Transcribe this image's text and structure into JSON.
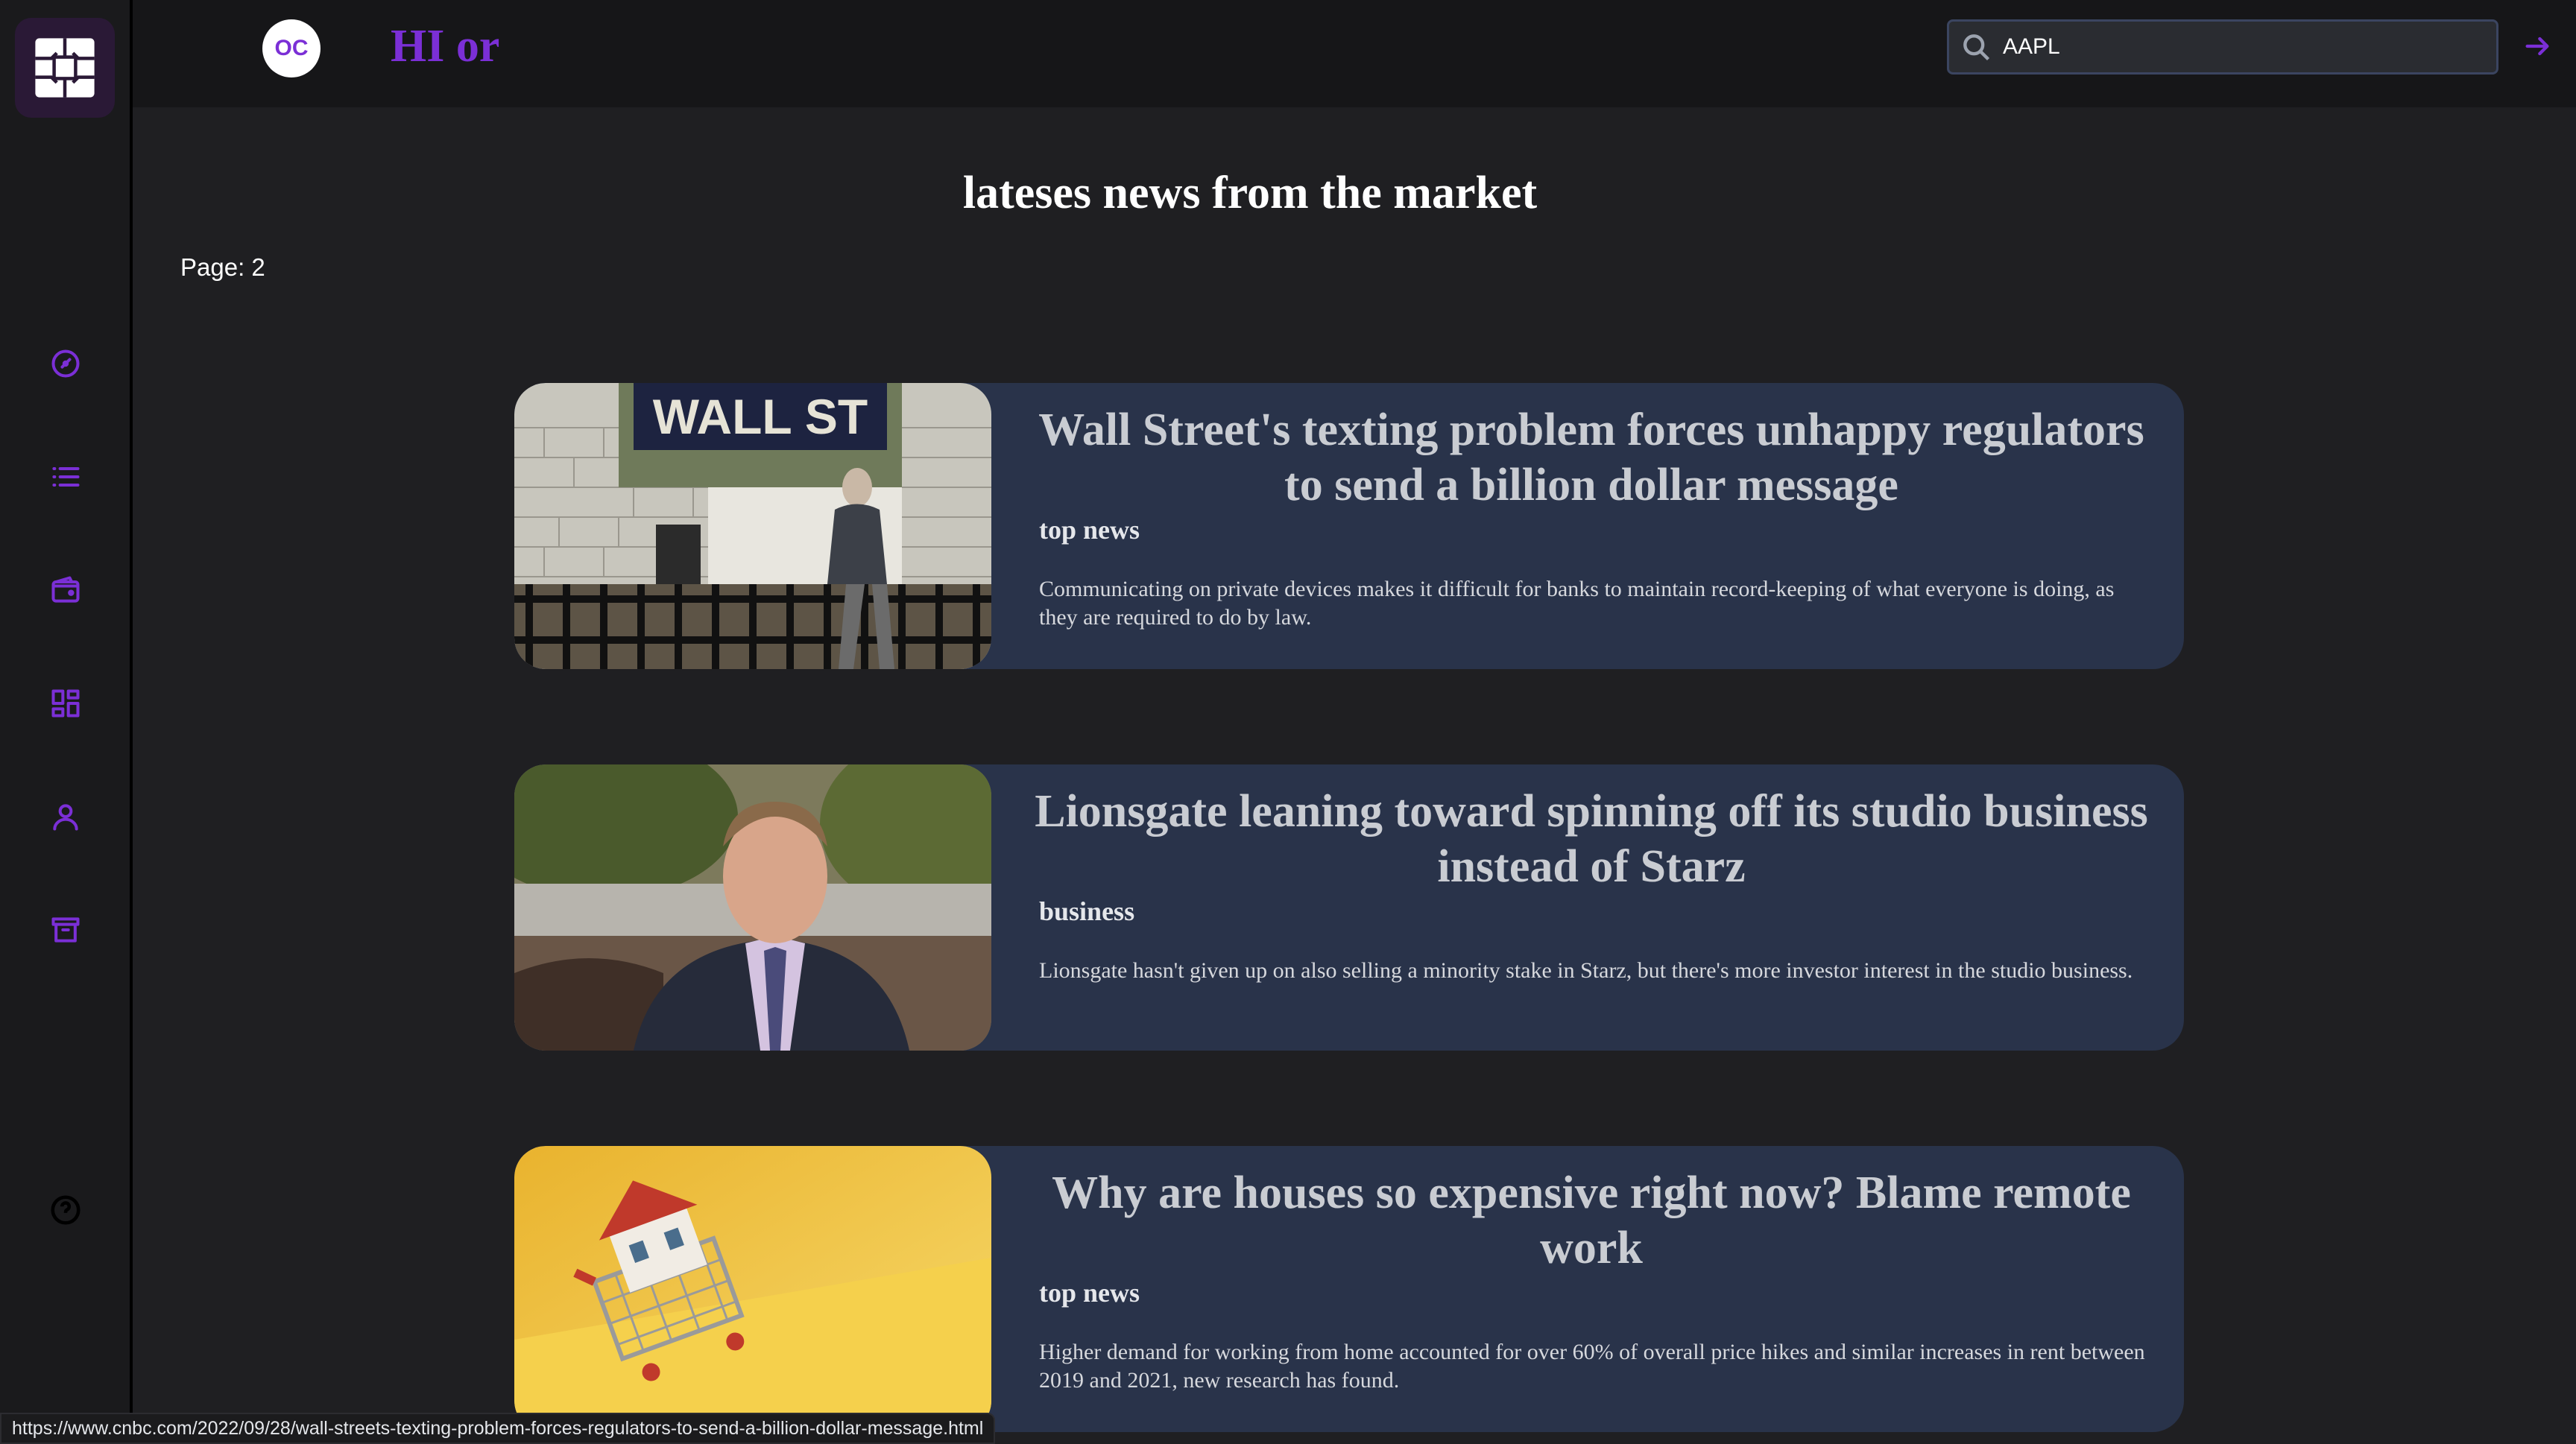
{
  "header": {
    "avatar_initials": "OC",
    "greeting": "HI or",
    "search": {
      "value": "AAPL",
      "placeholder": ""
    }
  },
  "page": {
    "title": "lateses news from the market",
    "page_label": "Page: 2"
  },
  "sidebar": {
    "items": [
      {
        "icon": "dashboard-gauge-icon"
      },
      {
        "icon": "list-icon"
      },
      {
        "icon": "wallet-icon"
      },
      {
        "icon": "grid-icon"
      },
      {
        "icon": "user-icon"
      },
      {
        "icon": "archive-icon"
      }
    ],
    "help_icon": "help-circle-icon"
  },
  "articles": [
    {
      "title": "Wall Street's texting problem forces unhappy regulators to send a billion dollar message",
      "category": "top news",
      "description": "Communicating on private devices makes it difficult for banks to maintain record-keeping of what everyone is doing, as they are required to do by law.",
      "image": "wall-street-subway-sign-photo"
    },
    {
      "title": "Lionsgate leaning toward spinning off its studio business instead of Starz",
      "category": "business",
      "description": "Lionsgate hasn't given up on also selling a minority stake in Starz, but there's more investor interest in the studio business.",
      "image": "executive-portrait-photo"
    },
    {
      "title": "Why are houses so expensive right now? Blame remote work",
      "category": "top news",
      "description": "Higher demand for working from home accounted for over 60% of overall price hikes and similar increases in rent between 2019 and 2021, new research has found.",
      "image": "house-in-shopping-cart-photo"
    }
  ],
  "status_bar": {
    "url": "https://www.cnbc.com/2022/09/28/wall-streets-texting-problem-forces-regulators-to-send-a-billion-dollar-message.html"
  },
  "colors": {
    "accent": "#7b2fd6",
    "card_bg": "#29334a",
    "page_bg": "#1f1f22"
  }
}
